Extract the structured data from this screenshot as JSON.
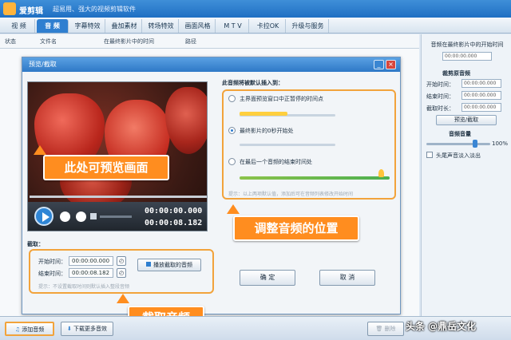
{
  "titlebar": {
    "app_name": "爱剪辑",
    "slogan": "超易用、强大的视频剪辑软件"
  },
  "tabs": [
    {
      "label": "视 频",
      "active": false
    },
    {
      "label": "音 频",
      "active": true
    },
    {
      "label": "字幕特效",
      "active": false
    },
    {
      "label": "叠加素材",
      "active": false
    },
    {
      "label": "转场特效",
      "active": false
    },
    {
      "label": "画面风格",
      "active": false
    },
    {
      "label": "M T V",
      "active": false
    },
    {
      "label": "卡拉OK",
      "active": false
    },
    {
      "label": "升级与服务",
      "active": false
    }
  ],
  "columns": [
    "状态",
    "文件名",
    "在最终影片中的时间",
    "路径"
  ],
  "right_panel": {
    "header": "音频在最终影片中的开始时间",
    "start_value": "00:00:00.000",
    "clip_section": "裁剪原音频",
    "start_label": "开始时间：",
    "end_label": "结束时间：",
    "clip_duration_label": "截取时长：",
    "field_value": "00:00:00.000",
    "preview_button": "预览/截取",
    "volume_section": "音频音量",
    "volume_value": "100%",
    "fade_label": "头尾声音淡入淡出"
  },
  "dialog": {
    "title": "预览/截取",
    "close_glyph": "×",
    "current_time": "00:00:00.000",
    "total_time": "00:00:08.182",
    "clip_title": "截取：",
    "start_label": "开始时间：",
    "end_label": "结束时间：",
    "start_value": "00:00:00.000",
    "end_value": "00:00:08.182",
    "play_button": "播放截取的音频",
    "hint_clip": "提示：不设置截取时间则默认插入整段音频",
    "insert_title": "此音频将被默认插入到：",
    "options": [
      {
        "label": "主界面预览窗口中正暂停的时间点",
        "selected": false
      },
      {
        "label": "最终影片的0秒开始处",
        "selected": true
      },
      {
        "label": "在最后一个音频的结束时间处",
        "selected": false
      }
    ],
    "hint_insert": "提示：以上两项默认值，添加后可在音频列表修改开始时间",
    "ok_button": "确 定",
    "cancel_button": "取 消"
  },
  "annotations": {
    "preview_callout": "此处可预览画面",
    "position_callout": "调整音频的位置",
    "clip_callout": "截取音频"
  },
  "bottombar": {
    "add_audio": "添加音频",
    "download_more": "下载更多音效",
    "delete_label": "删除"
  },
  "watermark": "头条 @鼎岳文化",
  "colors": {
    "accent": "#2f7fd0",
    "callout": "#ff8d1f",
    "callout_frame": "#f2a33b"
  }
}
